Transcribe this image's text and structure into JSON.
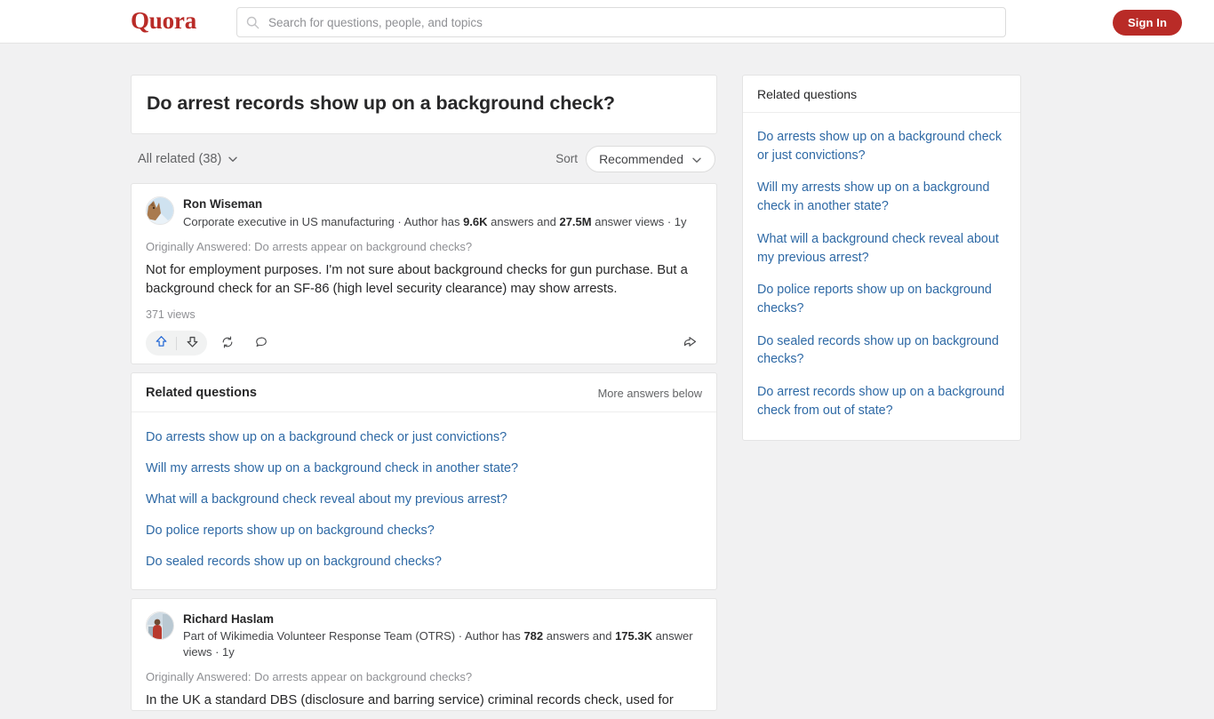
{
  "header": {
    "logo": "Quora",
    "search": {
      "placeholder": "Search for questions, people, and topics",
      "value": "",
      "icon": "search-icon"
    },
    "signin_label": "Sign In",
    "brand_color": "#b92b27"
  },
  "question": {
    "title": "Do arrest records show up on a background check?"
  },
  "filter_bar": {
    "all_related_label": "All related (38)",
    "sort_label": "Sort",
    "sort_value": "Recommended",
    "sort_options": [
      "Recommended"
    ]
  },
  "answers": [
    {
      "author_name": "Ron Wiseman",
      "credential_prefix": "Corporate executive in US manufacturing · Author has ",
      "answers_count": "9.6K",
      "credential_middle": " answers and ",
      "views_count": "27.5M",
      "credential_suffix": " answer views · 1y",
      "originally_answered": "Originally Answered: Do arrests appear on background checks?",
      "body": "Not for employment purposes. I'm not sure about background checks for gun purchase. But a background check for an SF-86 (high level security clearance) may show arrests.",
      "views": "371 views",
      "actions": {
        "upvote": "upvote-icon",
        "downvote": "downvote-icon",
        "repost": "repost-icon",
        "comment": "comment-icon",
        "share": "share-icon"
      }
    },
    {
      "author_name": "Richard Haslam",
      "credential_prefix": "Part of Wikimedia Volunteer Response Team (OTRS) · Author has ",
      "answers_count": "782",
      "credential_middle": " answers and ",
      "views_count": "175.3K",
      "credential_suffix": " answer views · 1y",
      "originally_answered": "Originally Answered: Do arrests appear on background checks?",
      "body": "In the UK a standard DBS (disclosure and barring service) criminal records check, used for",
      "views": "",
      "actions": {}
    }
  ],
  "feed_related": {
    "title": "Related questions",
    "more_label": "More answers below",
    "links": [
      "Do arrests show up on a background check or just convictions?",
      "Will my arrests show up on a background check in another state?",
      "What will a background check reveal about my previous arrest?",
      "Do police reports show up on background checks?",
      "Do sealed records show up on background checks?"
    ]
  },
  "rail_related": {
    "title": "Related questions",
    "links": [
      "Do arrests show up on a background check or just convictions?",
      "Will my arrests show up on a background check in another state?",
      "What will a background check reveal about my previous arrest?",
      "Do police reports show up on background checks?",
      "Do sealed records show up on background checks?",
      "Do arrest records show up on a background check from out of state?"
    ]
  }
}
